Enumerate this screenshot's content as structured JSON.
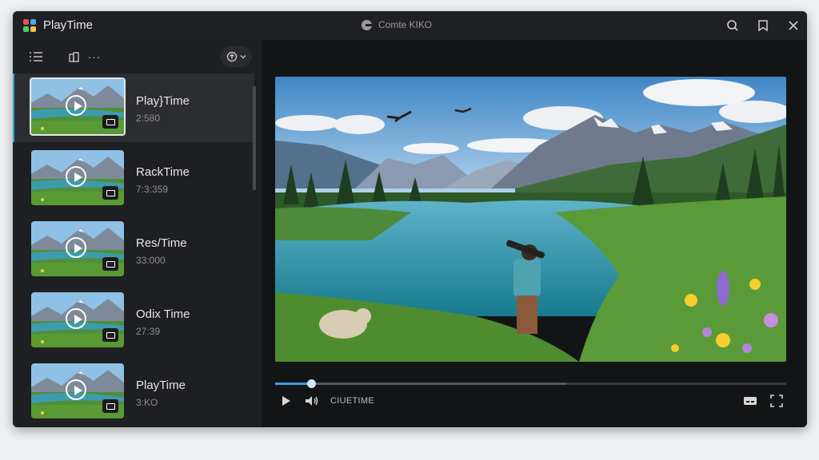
{
  "window": {
    "app_title": "PlayTime",
    "center_title": "Comte ΚΙΚΟ",
    "controls": [
      "search-icon",
      "bookmark-icon",
      "close-icon"
    ]
  },
  "sidebar": {
    "toolbar_icons": [
      "list-icon",
      "library-icon",
      "more-icon",
      "filter-icon"
    ],
    "more_label": "···",
    "items": [
      {
        "title": "Play}Time",
        "subtitle": "2:580",
        "active": true
      },
      {
        "title": "RackTime",
        "subtitle": "7:3:359",
        "active": false
      },
      {
        "title": "Res/Time",
        "subtitle": "33:000",
        "active": false
      },
      {
        "title": "Odix Time",
        "subtitle": "27:39",
        "active": false
      },
      {
        "title": "PlayTime",
        "subtitle": "3:KO",
        "active": false
      }
    ]
  },
  "player": {
    "progress": 0.07,
    "buffered": 0.57,
    "label": "CIUETIME",
    "controls": [
      "play-icon",
      "volume-icon",
      "subtitles-icon",
      "fullscreen-icon"
    ]
  },
  "colors": {
    "accent": "#2aa7e0",
    "window_bg": "#1e1f22",
    "player_bg": "#131416"
  }
}
